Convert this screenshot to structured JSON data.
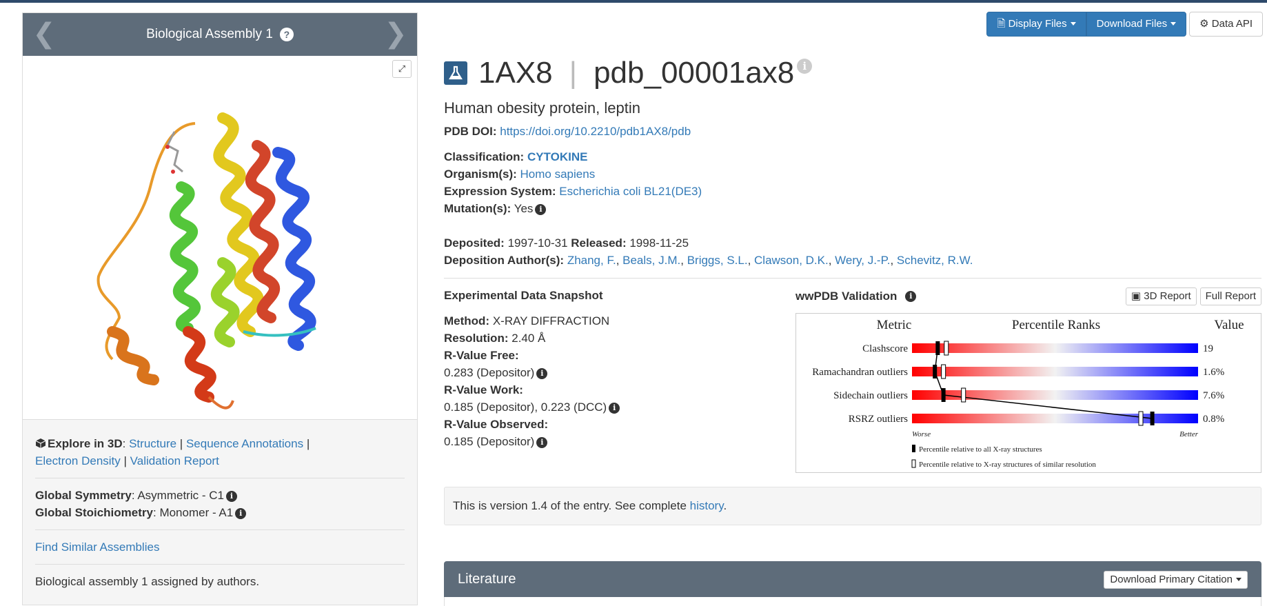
{
  "assembly": {
    "title": "Biological Assembly 1",
    "explore_label": "Explore in 3D",
    "explore_links": [
      "Structure",
      "Sequence Annotations",
      "Electron Density",
      "Validation Report"
    ],
    "global_symmetry_label": "Global Symmetry",
    "global_symmetry_value": "Asymmetric - C1",
    "global_stoichiometry_label": "Global Stoichiometry",
    "global_stoichiometry_value": "Monomer - A1",
    "find_similar": "Find Similar Assemblies",
    "note": "Biological assembly 1 assigned by authors."
  },
  "toolbar": {
    "display_files": "Display Files",
    "download_files": "Download Files",
    "data_api": "Data API"
  },
  "entry": {
    "id": "1AX8",
    "pdb_id": "pdb_00001ax8",
    "title": "Human obesity protein, leptin",
    "doi_label": "PDB DOI:",
    "doi": "https://doi.org/10.2210/pdb1AX8/pdb",
    "classification_label": "Classification:",
    "classification": "CYTOKINE",
    "organism_label": "Organism(s):",
    "organism": "Homo sapiens",
    "expression_label": "Expression System:",
    "expression": "Escherichia coli BL21(DE3)",
    "mutation_label": "Mutation(s):",
    "mutation": "Yes",
    "deposited_label": "Deposited:",
    "deposited": "1997-10-31",
    "released_label": "Released:",
    "released": "1998-11-25",
    "authors_label": "Deposition Author(s):",
    "authors": [
      "Zhang, F.",
      "Beals, J.M.",
      "Briggs, S.L.",
      "Clawson, D.K.",
      "Wery, J.-P.",
      "Schevitz, R.W."
    ]
  },
  "experimental": {
    "heading": "Experimental Data Snapshot",
    "method_label": "Method:",
    "method": "X-RAY DIFFRACTION",
    "resolution_label": "Resolution:",
    "resolution": "2.40 Å",
    "rfree_label": "R-Value Free:",
    "rfree": "0.283 (Depositor)",
    "rwork_label": "R-Value Work:",
    "rwork": "0.185 (Depositor), 0.223 (DCC)",
    "robs_label": "R-Value Observed:",
    "robs": "0.185 (Depositor)"
  },
  "validation": {
    "heading": "wwPDB Validation",
    "report_3d": "3D Report",
    "report_full": "Full Report",
    "col_metric": "Metric",
    "col_percentile": "Percentile Ranks",
    "col_value": "Value",
    "worse": "Worse",
    "better": "Better",
    "legend_all": "Percentile relative to all X-ray structures",
    "legend_similar": "Percentile relative to X-ray structures of similar resolution"
  },
  "chart_data": {
    "type": "bar",
    "categories": [
      "Clashscore",
      "Ramachandran outliers",
      "Sidechain outliers",
      "RSRZ outliers"
    ],
    "value_labels": [
      "19",
      "1.6%",
      "7.6%",
      "0.8%"
    ],
    "series": [
      {
        "name": "Percentile relative to all X-ray structures",
        "values": [
          9,
          8,
          11,
          84
        ]
      },
      {
        "name": "Percentile relative to X-ray structures of similar resolution",
        "values": [
          12,
          11,
          18,
          80
        ]
      }
    ],
    "ylim": [
      0,
      100
    ]
  },
  "version_bar": {
    "text": "This is version 1.4 of the entry. See complete ",
    "link": "history",
    "end": "."
  },
  "literature": {
    "title": "Literature",
    "button": "Download Primary Citation"
  },
  "colors": {
    "panel_header": "#5e6c7a",
    "primary": "#337ab7",
    "link": "#337ab7"
  }
}
